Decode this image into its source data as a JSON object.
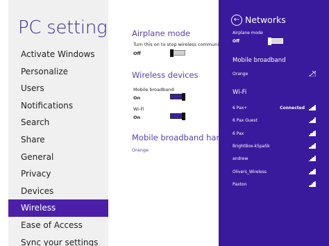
{
  "nav": {
    "title": "PC settings",
    "items": [
      {
        "label": "Activate Windows"
      },
      {
        "label": "Personalize"
      },
      {
        "label": "Users"
      },
      {
        "label": "Notifications"
      },
      {
        "label": "Search"
      },
      {
        "label": "Share"
      },
      {
        "label": "General"
      },
      {
        "label": "Privacy"
      },
      {
        "label": "Devices"
      },
      {
        "label": "Wireless",
        "active": true
      },
      {
        "label": "Ease of Access"
      },
      {
        "label": "Sync your settings"
      }
    ]
  },
  "content": {
    "airplane": {
      "title": "Airplane mode",
      "description": "Turn this on to stop wireless communication",
      "state": "Off"
    },
    "wireless": {
      "title": "Wireless devices",
      "mobile_label": "Mobile broadband",
      "mobile_state": "On",
      "wifi_label": "Wi-Fi",
      "wifi_state": "On"
    },
    "hardware": {
      "title": "Mobile broadband hardware",
      "link": "Orange"
    }
  },
  "flyout": {
    "title": "Networks",
    "airplane_label": "Airplane mode",
    "airplane_state": "Off",
    "mobile_heading": "Mobile broadband",
    "mobile_network": "Orange",
    "wifi_heading": "Wi-Fi",
    "networks": [
      {
        "name": "6 Pax+",
        "status": "Connected",
        "signal": 5
      },
      {
        "name": "6 Pax Guest",
        "status": "",
        "signal": 5
      },
      {
        "name": "6 Pax",
        "status": "",
        "signal": 5
      },
      {
        "name": "BrightBox-k5pa5k",
        "status": "",
        "signal": 5
      },
      {
        "name": "andrew",
        "status": "",
        "signal": 5
      },
      {
        "name": "Olivers_Wireless",
        "status": "",
        "signal": 5
      },
      {
        "name": "Paxton",
        "status": "",
        "signal": 5
      }
    ]
  },
  "colors": {
    "accent": "#4b1fa8",
    "flyout_bg": "#3a1a9c",
    "heading": "#5a3fa8"
  }
}
